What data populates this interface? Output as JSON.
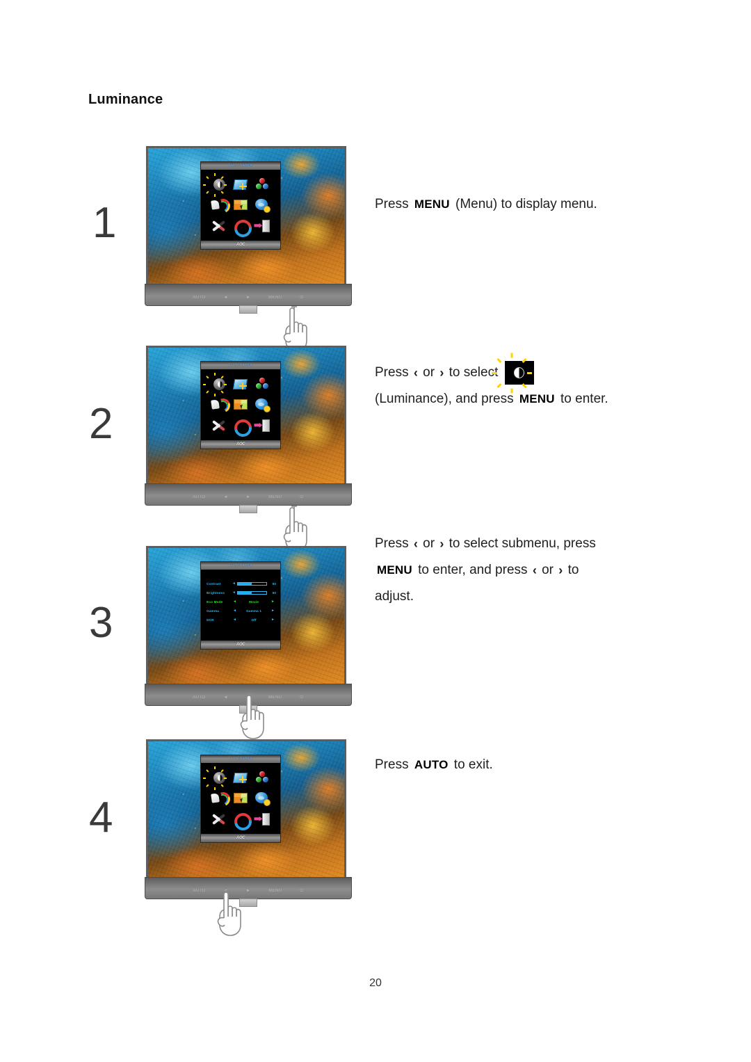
{
  "document": {
    "heading": "Luminance",
    "page_number": "20"
  },
  "osd": {
    "title": "Luminance",
    "brand": "AOC",
    "bezel_buttons": [
      "AUTO",
      "◄",
      "►",
      "MENU",
      "⏻"
    ],
    "icons": [
      {
        "name": "luminance-icon",
        "label": "Luminance"
      },
      {
        "name": "image-setup-icon",
        "label": "Image Setup"
      },
      {
        "name": "color-temp-icon",
        "label": "Color Temperature"
      },
      {
        "name": "picture-boost-icon",
        "label": "Picture Boost"
      },
      {
        "name": "osd-setup-icon",
        "label": "OSD Setup"
      },
      {
        "name": "extra-icon",
        "label": "Extra"
      },
      {
        "name": "tools-icon",
        "label": "Tools"
      },
      {
        "name": "reset-icon",
        "label": "Reset"
      },
      {
        "name": "exit-icon",
        "label": "Exit"
      }
    ],
    "submenu_rows": [
      {
        "label": "Contrast",
        "type": "slider",
        "value": "50",
        "percent": 50,
        "left_arrow": "◄",
        "right_arrow": "►",
        "selected": false
      },
      {
        "label": "Brightness",
        "type": "slider",
        "value": "50",
        "percent": 50,
        "left_arrow": "◄",
        "right_arrow": "►",
        "selected": false
      },
      {
        "label": "Eco Mode",
        "type": "option",
        "value": "Movie",
        "left_arrow": "◄",
        "right_arrow": "►",
        "selected": true
      },
      {
        "label": "Gamma",
        "type": "option",
        "value": "Gamma 1",
        "left_arrow": "◄",
        "right_arrow": "►",
        "selected": false
      },
      {
        "label": "DCR",
        "type": "option",
        "value": "Off",
        "left_arrow": "◄",
        "right_arrow": "►",
        "selected": false
      }
    ]
  },
  "steps": [
    {
      "number": "1",
      "screen": "main-menu",
      "text": {
        "line1_a": "Press",
        "key1": "MENU",
        "line1_b": "(Menu) to display menu."
      }
    },
    {
      "number": "2",
      "screen": "main-menu",
      "text": {
        "line1_a": "Press",
        "left_glyph": "‹",
        "or": "or",
        "right_glyph": "›",
        "line1_b": "to select",
        "line2_a": "(Luminance), and press",
        "key1": "MENU",
        "line2_b": "to enter."
      }
    },
    {
      "number": "3",
      "screen": "submenu",
      "text": {
        "line1_a": "Press",
        "left_glyph": "‹",
        "or": "or",
        "right_glyph": "›",
        "line1_b": "to select submenu, press",
        "key1": "MENU",
        "line2_a": "to enter, and press",
        "line2_b": "to",
        "line3": "adjust."
      }
    },
    {
      "number": "4",
      "screen": "main-menu",
      "text": {
        "line1_a": "Press",
        "key1": "AUTO",
        "line1_b": "to exit."
      }
    }
  ],
  "colors": {
    "osd_title_text": "#6fa8e0",
    "osd_item_text": "#2fb9f5",
    "osd_selected_text": "#2ee02e",
    "slider_fill": "#2aa8ef",
    "accent_yellow": "#ffd400"
  }
}
